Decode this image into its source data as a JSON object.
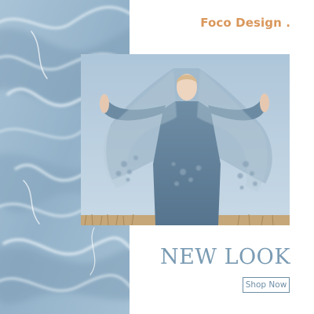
{
  "brand": {
    "name": "Foco Design",
    "dot": "."
  },
  "hero": {
    "headline": "NEW LOOK",
    "cta_label": "Shop Now"
  },
  "colors": {
    "accent": "#d9975b",
    "headline": "#7a9bb3",
    "cta_border": "#6e8fa6",
    "texture_base": "#9dbad0",
    "sky": "#b9cfe0"
  },
  "images": {
    "texture": "blue-fluid-texture",
    "photo": "model-in-lace-veil"
  }
}
